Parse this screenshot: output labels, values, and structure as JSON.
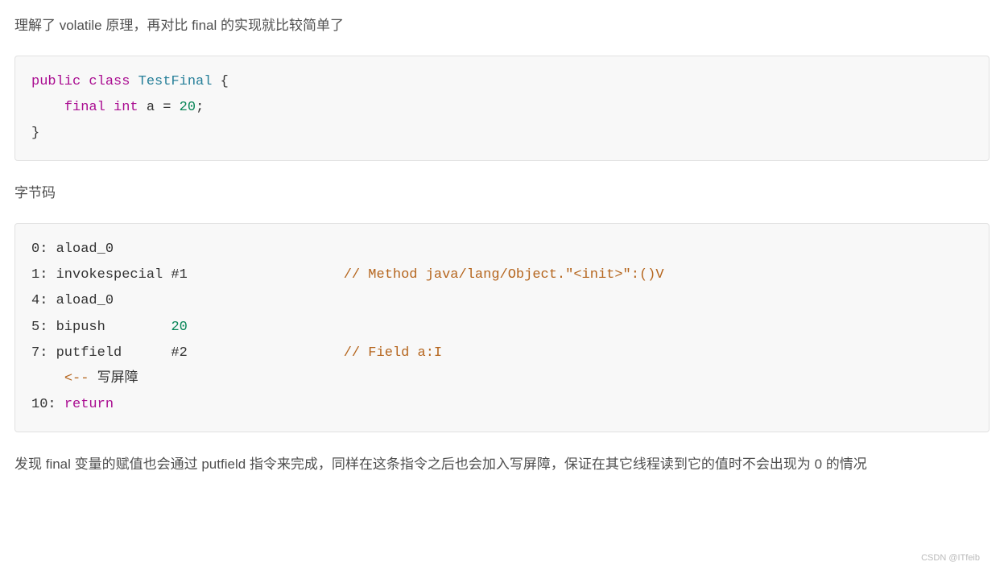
{
  "paragraphs": {
    "intro": "理解了 volatile 原理，再对比 final 的实现就比较简单了",
    "bytecode_label": "字节码",
    "conclusion": "发现 final 变量的赋值也会通过 putfield 指令来完成，同样在这条指令之后也会加入写屏障，保证在其它线程读到它的值时不会出现为 0 的情况"
  },
  "code1": {
    "kw_public": "public",
    "kw_class": "class",
    "type_name": "TestFinal",
    "brace_open": "{",
    "kw_final": "final",
    "kw_int": "int",
    "var_assign": "a = ",
    "num_20": "20",
    "semicolon": ";",
    "brace_close": "}"
  },
  "code2": {
    "l0_num": "0:",
    "l0_instr": "aload_0",
    "l1_num": "1:",
    "l1_instr": "invokespecial #1",
    "l1_comment": "// Method java/lang/Object.\"<init>\":()V",
    "l4_num": "4:",
    "l4_instr": "aload_0",
    "l5_num": "5:",
    "l5_instr": "bipush",
    "l5_arg": "20",
    "l7_num": "7:",
    "l7_instr": "putfield      #2",
    "l7_comment": "// Field a:I",
    "barrier_arrow": "<--",
    "barrier_text": "写屏障",
    "l10_num": "10:",
    "l10_instr": "return"
  },
  "footer": "CSDN @ITfeib"
}
